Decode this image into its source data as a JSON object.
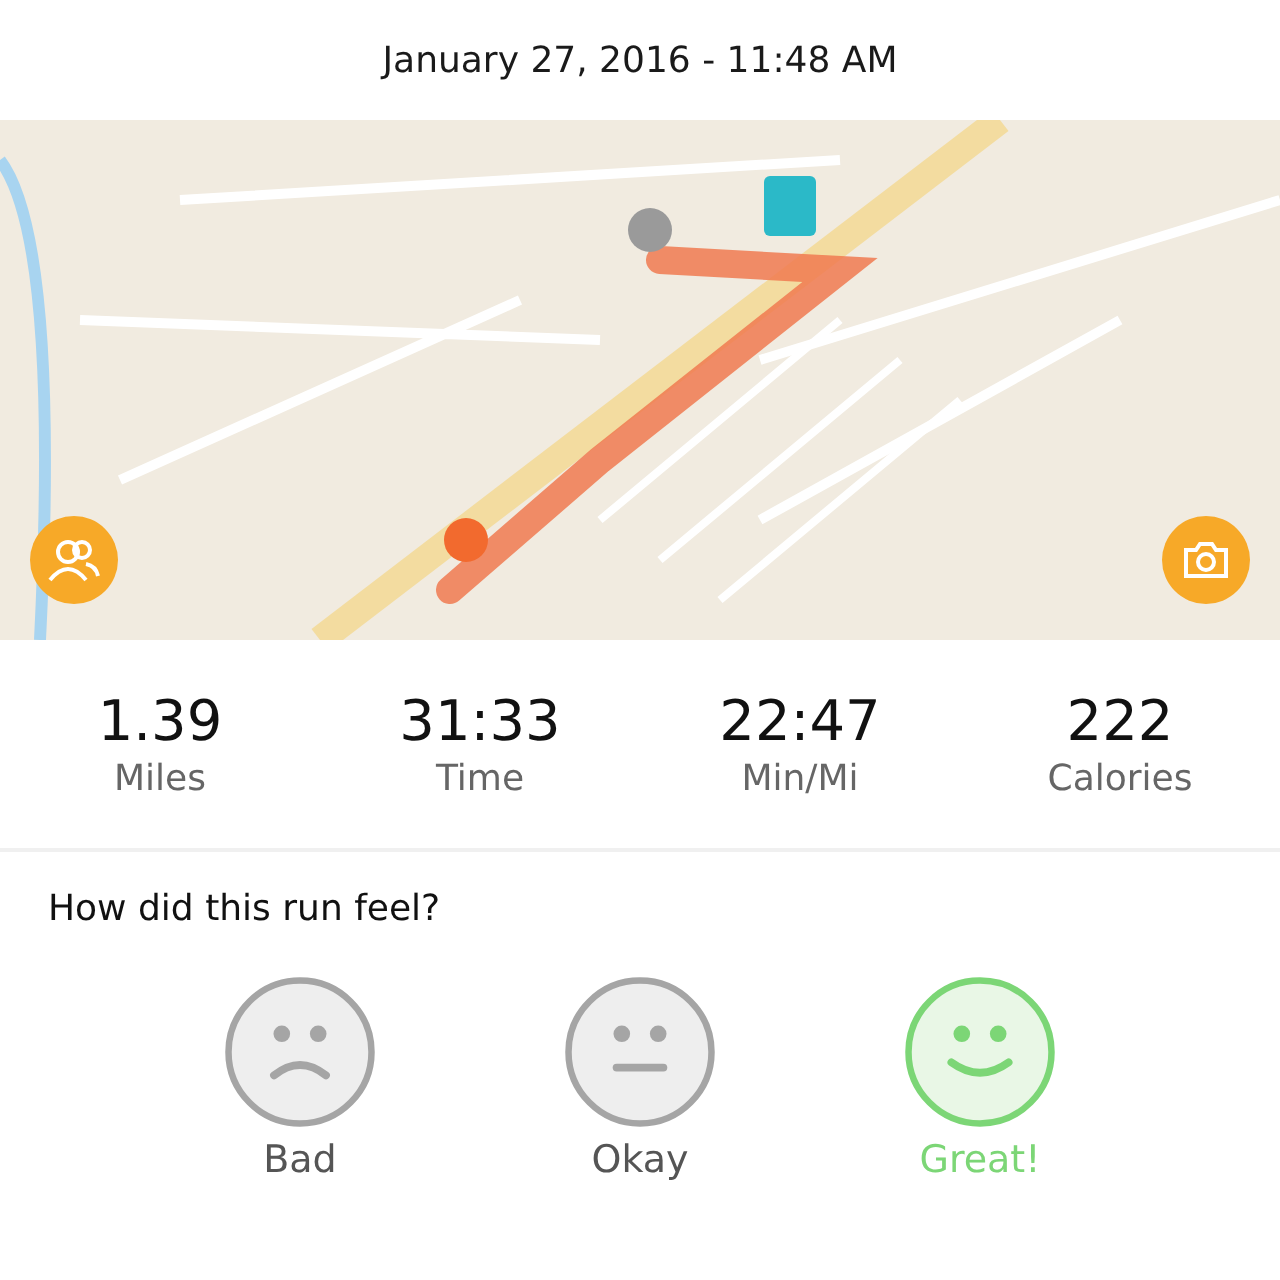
{
  "header": {
    "title": "January 27, 2016 - 11:48 AM"
  },
  "stats": [
    {
      "value": "1.39",
      "label": "Miles"
    },
    {
      "value": "31:33",
      "label": "Time"
    },
    {
      "value": "22:47",
      "label": "Min/Mi"
    },
    {
      "value": "222",
      "label": "Calories"
    }
  ],
  "feel": {
    "question": "How did this run feel?",
    "options": [
      {
        "kind": "sad",
        "label": "Bad",
        "selected": false
      },
      {
        "kind": "neutral",
        "label": "Okay",
        "selected": false
      },
      {
        "kind": "happy",
        "label": "Great!",
        "selected": true
      }
    ]
  }
}
